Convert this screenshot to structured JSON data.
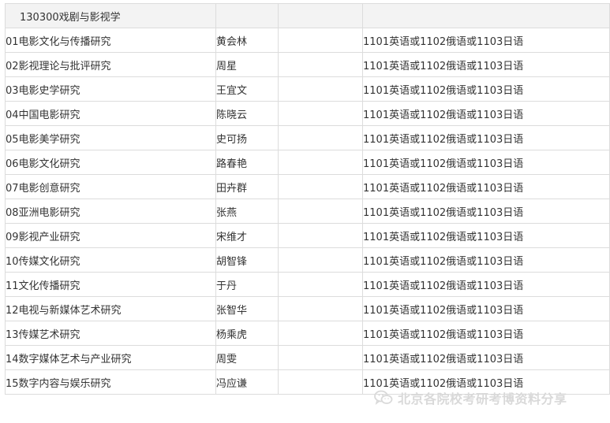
{
  "table": {
    "header": {
      "program": "130300戏剧与影视学",
      "tutor": "",
      "blank": "",
      "language": ""
    },
    "rows": [
      {
        "direction": "01电影文化与传播研究",
        "tutor": "黄会林",
        "language": "1101英语或1102俄语或1103日语"
      },
      {
        "direction": "02影视理论与批评研究",
        "tutor": "周星",
        "language": "1101英语或1102俄语或1103日语"
      },
      {
        "direction": "03电影史学研究",
        "tutor": "王宜文",
        "language": "1101英语或1102俄语或1103日语"
      },
      {
        "direction": "04中国电影研究",
        "tutor": "陈晓云",
        "language": "1101英语或1102俄语或1103日语"
      },
      {
        "direction": "05电影美学研究",
        "tutor": "史可扬",
        "language": "1101英语或1102俄语或1103日语"
      },
      {
        "direction": "06电影文化研究",
        "tutor": "路春艳",
        "language": "1101英语或1102俄语或1103日语"
      },
      {
        "direction": "07电影创意研究",
        "tutor": "田卉群",
        "language": "1101英语或1102俄语或1103日语"
      },
      {
        "direction": "08亚洲电影研究",
        "tutor": "张燕",
        "language": "1101英语或1102俄语或1103日语"
      },
      {
        "direction": "09影视产业研究",
        "tutor": "宋维才",
        "language": "1101英语或1102俄语或1103日语"
      },
      {
        "direction": "10传媒文化研究",
        "tutor": "胡智锋",
        "language": "1101英语或1102俄语或1103日语"
      },
      {
        "direction": "11文化传播研究",
        "tutor": "于丹",
        "language": "1101英语或1102俄语或1103日语"
      },
      {
        "direction": "12电视与新媒体艺术研究",
        "tutor": "张智华",
        "language": "1101英语或1102俄语或1103日语"
      },
      {
        "direction": "13传媒艺术研究",
        "tutor": "杨乘虎",
        "language": "1101英语或1102俄语或1103日语"
      },
      {
        "direction": "14数字媒体艺术与产业研究",
        "tutor": "周雯",
        "language": "1101英语或1102俄语或1103日语"
      },
      {
        "direction": "15数字内容与娱乐研究",
        "tutor": "冯应谦",
        "language": "1101英语或1102俄语或1103日语"
      }
    ]
  },
  "watermark": {
    "icon": "wechat-icon",
    "text": "北京各院校考研考博资料分享",
    "color": "#d9d9d9"
  }
}
